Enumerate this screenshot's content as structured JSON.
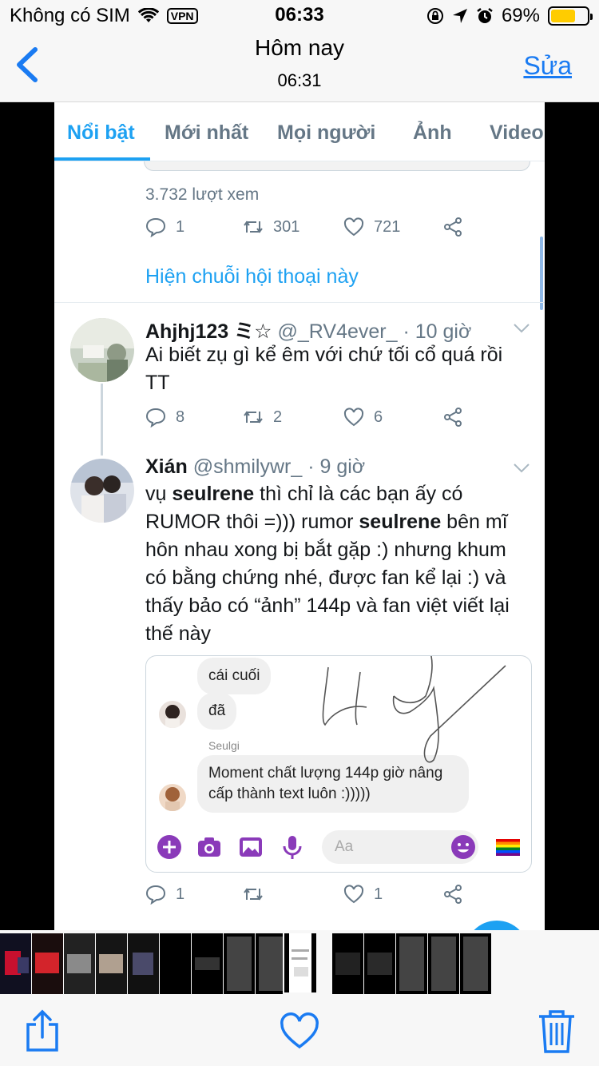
{
  "status_bar": {
    "carrier": "Không có SIM",
    "vpn": "VPN",
    "time": "06:33",
    "battery": "69%",
    "battery_level": 0.69,
    "battery_color": "#ffcc00"
  },
  "nav": {
    "title": "Hôm nay",
    "subtitle": "06:31",
    "edit_label": "Sửa",
    "accent": "#1a7bf2"
  },
  "twitter": {
    "accent": "#1da1f2",
    "tabs": [
      "Nổi bật",
      "Mới nhất",
      "Mọi người",
      "Ảnh",
      "Video"
    ],
    "active_tab": 0,
    "prev_tweet": {
      "views": "3.732 lượt xem",
      "replies": "1",
      "retweets": "301",
      "likes": "721"
    },
    "show_thread": "Hiện chuỗi hội thoại này",
    "tweet1": {
      "name": "Ahjhj123 ミ☆",
      "handle": "@_RV4ever_",
      "time": "· 10 giờ",
      "text": "Ai biết zụ gì kể êm với chứ tối cổ quá rồi TT",
      "replies": "8",
      "retweets": "2",
      "likes": "6"
    },
    "tweet2": {
      "name": "Xián",
      "handle": "@shmilywr_",
      "time": "· 9 giờ",
      "text_parts": {
        "p1": "vụ ",
        "b1": "seulrene",
        "p2": " thì chỉ là các bạn ấy có RUMOR thôi =))) rumor ",
        "b2": "seulrene",
        "p3": " bên mĩ hôn nhau xong bị bắt gặp :) nhưng khum có bằng chứng nhé, được fan kể lại :) và thấy bảo có “ảnh” 144p và fan việt viết lại thế này"
      },
      "replies": "1",
      "retweets": "",
      "likes": "1"
    },
    "embed": {
      "bubble1": "cái cuối",
      "bubble2": "đã",
      "sender": "Seulgi",
      "bubble3": "Moment chất lượng 144p giờ nâng cấp thành text luôn :)))))",
      "input_placeholder": "Aa",
      "messenger_color": "#8a3ab9"
    }
  },
  "toolbar": {
    "icons": [
      "share-icon",
      "heart-icon",
      "trash-icon"
    ]
  }
}
